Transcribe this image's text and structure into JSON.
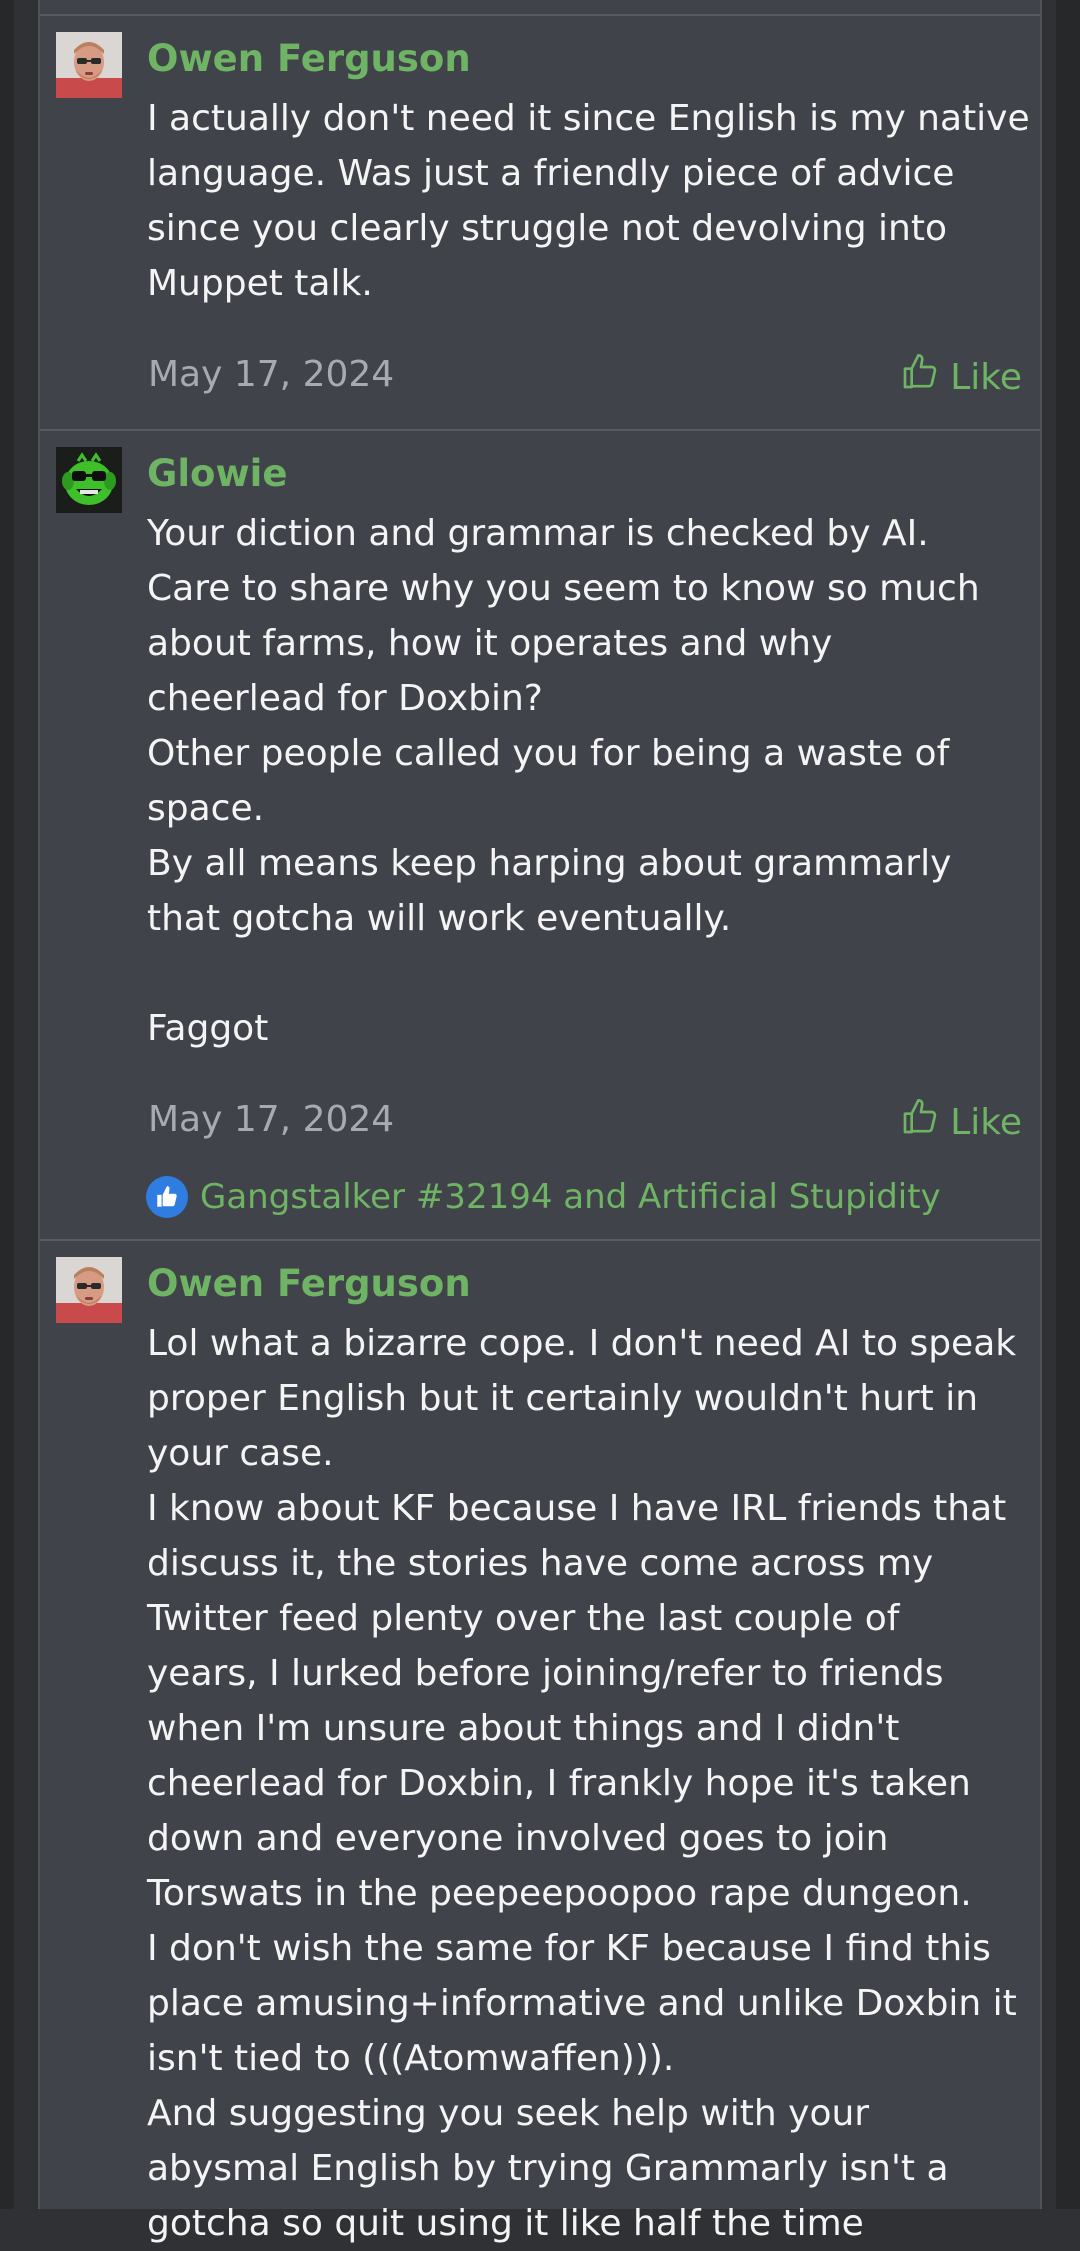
{
  "posts": [
    {
      "author": "Owen Ferguson",
      "lines": [
        "I actually don't need it since English is my native",
        "language. Was just a friendly piece of advice",
        "since you clearly struggle not devolving into",
        "Muppet talk."
      ],
      "date": "May 17, 2024",
      "like_label": "Like"
    },
    {
      "author": "Glowie",
      "lines": [
        "Your diction and grammar is checked by AI.",
        "Care to share why you seem to know so much",
        "about farms, how it operates and why",
        "cheerlead for Doxbin?",
        "Other people called you for being a waste of",
        "space.",
        "By all means keep harping about grammarly",
        "that gotcha will work eventually.",
        "",
        "Faggot"
      ],
      "date": "May 17, 2024",
      "like_label": "Like",
      "reactions_text": "Gangstalker #32194 and Artificial Stupidity"
    },
    {
      "author": "Owen Ferguson",
      "lines": [
        "Lol what a bizarre cope. I don't need AI to speak",
        "proper English but it certainly wouldn't hurt in",
        "your case.",
        "I know about KF because I have IRL friends that",
        "discuss it, the stories have come across my",
        "Twitter feed plenty over the last couple of",
        "years, I lurked before joining/refer to friends",
        "when I'm unsure about things and I didn't",
        "cheerlead for Doxbin, I frankly hope it's taken",
        "down and everyone involved goes to join",
        "Torswats in the peepeepoopoo rape dungeon.",
        "I don't wish the same for KF because I find this",
        "place amusing+informative and unlike Doxbin it",
        "isn't tied to (((Atomwaffen))).",
        "And suggesting you seek help with your",
        "abysmal English by trying Grammarly isn't a",
        "gotcha so quit using it like half the time"
      ]
    }
  ],
  "colors": {
    "accent": "#6fb364",
    "panel": "#404349",
    "background": "#2f3134",
    "reaction": "#2f7de1"
  }
}
